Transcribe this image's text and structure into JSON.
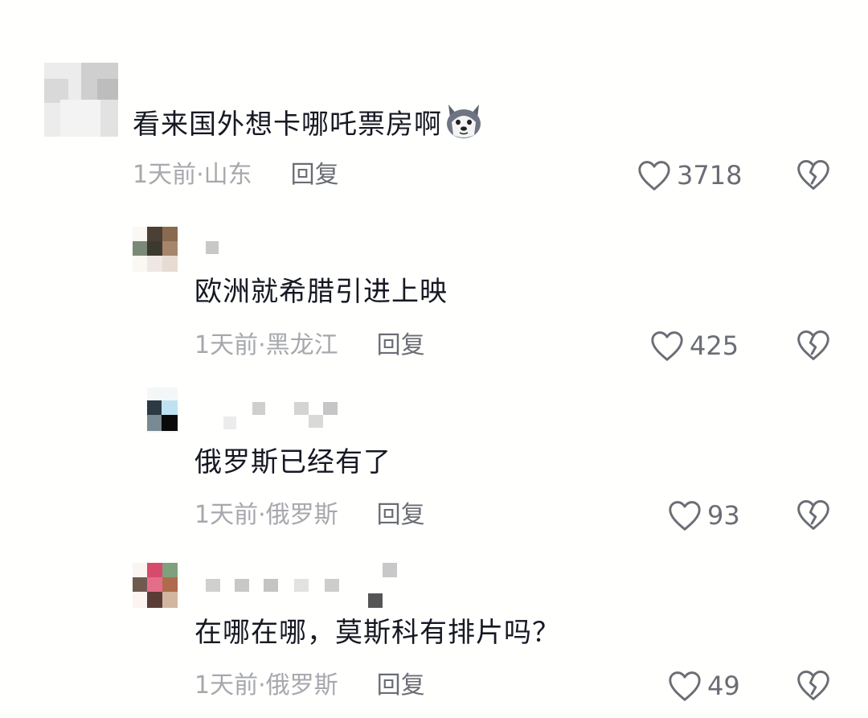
{
  "comments": [
    {
      "text": "看来国外想卡哪吒票房啊",
      "emoji": "husky-dog-face-emoji",
      "time": "1天前·山东",
      "reply": "回复",
      "likes": "3718",
      "icons": {
        "like": "heart-outline-icon",
        "dislike": "broken-heart-icon"
      }
    },
    {
      "text": "欧洲就希腊引进上映",
      "time": "1天前·黑龙江",
      "reply": "回复",
      "likes": "425",
      "icons": {
        "like": "heart-outline-icon",
        "dislike": "broken-heart-icon"
      }
    },
    {
      "text": "俄罗斯已经有了",
      "time": "1天前·俄罗斯",
      "reply": "回复",
      "likes": "93",
      "icons": {
        "like": "heart-outline-icon",
        "dislike": "broken-heart-icon"
      }
    },
    {
      "text": "在哪在哪，莫斯科有排片吗？",
      "time": "1天前·俄罗斯",
      "reply": "回复",
      "likes": "49",
      "icons": {
        "like": "heart-outline-icon",
        "dislike": "broken-heart-icon"
      }
    }
  ],
  "colors": {
    "text": "#161823",
    "time": "#a7a8ae",
    "reply": "#6b6d75",
    "icon": "#6b6d75",
    "background": "#fffffd"
  }
}
